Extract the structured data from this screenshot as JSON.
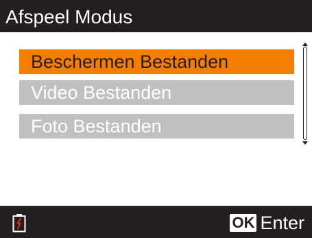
{
  "header": {
    "title": "Afspeel Modus"
  },
  "menu": {
    "items": [
      {
        "label": "Beschermen Bestanden",
        "selected": true
      },
      {
        "label": "Video Bestanden",
        "selected": false
      },
      {
        "label": "Foto Bestanden",
        "selected": false
      }
    ]
  },
  "footer": {
    "battery_icon": "battery-low-icon",
    "ok_label": "OK",
    "enter_label": "Enter"
  },
  "colors": {
    "bar_background": "#231f20",
    "selected_item": "#f37e00",
    "unselected_item": "#c0c0c0",
    "battery_indicator": "#e0221a"
  }
}
